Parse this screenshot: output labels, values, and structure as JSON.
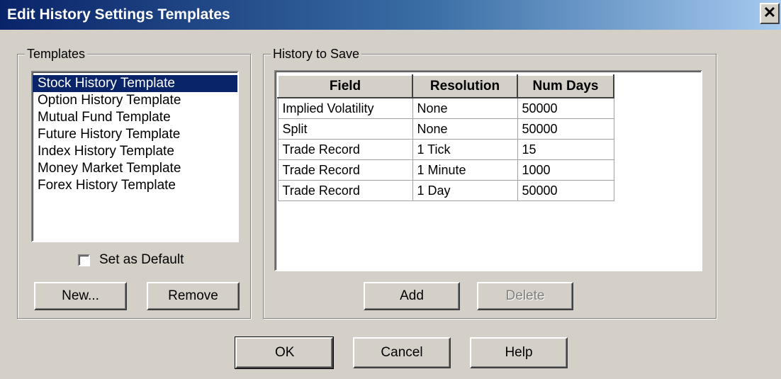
{
  "window": {
    "title": "Edit History Settings Templates",
    "close_glyph": "✕"
  },
  "templates": {
    "group_label": "Templates",
    "items": [
      {
        "label": "Stock History Template",
        "selected": true
      },
      {
        "label": "Option History Template",
        "selected": false
      },
      {
        "label": "Mutual Fund Template",
        "selected": false
      },
      {
        "label": "Future History Template",
        "selected": false
      },
      {
        "label": "Index History Template",
        "selected": false
      },
      {
        "label": "Money Market Template",
        "selected": false
      },
      {
        "label": "Forex History Template",
        "selected": false
      }
    ],
    "set_default_label": "Set as Default",
    "set_default_checked": false,
    "new_label": "New...",
    "remove_label": "Remove"
  },
  "history": {
    "group_label": "History to Save",
    "columns": [
      "Field",
      "Resolution",
      "Num Days"
    ],
    "rows": [
      [
        "Implied Volatility",
        "None",
        "50000"
      ],
      [
        "Split",
        "None",
        "50000"
      ],
      [
        "Trade Record",
        "1 Tick",
        "15"
      ],
      [
        "Trade Record",
        "1 Minute",
        "1000"
      ],
      [
        "Trade Record",
        "1 Day",
        "50000"
      ]
    ],
    "add_label": "Add",
    "delete_label": "Delete",
    "delete_enabled": false
  },
  "footer": {
    "ok_label": "OK",
    "cancel_label": "Cancel",
    "help_label": "Help"
  },
  "colors": {
    "face": "#d4d0c8",
    "selection": "#0a246a",
    "title_start": "#0a246a",
    "title_end": "#a6caf0"
  }
}
